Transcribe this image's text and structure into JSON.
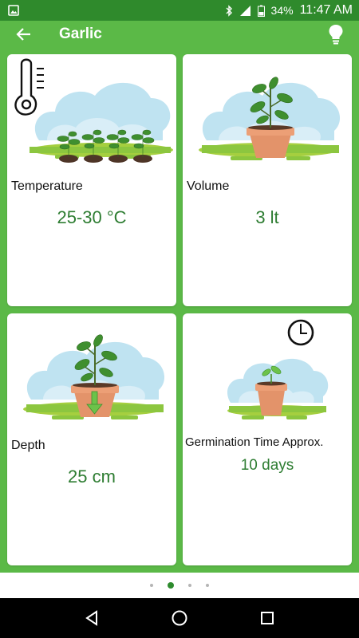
{
  "status_bar": {
    "battery": "34%",
    "time": "11:47 AM"
  },
  "app_bar": {
    "title": "Garlic"
  },
  "cards": [
    {
      "label": "Temperature",
      "value": "25-30 °C"
    },
    {
      "label": "Volume",
      "value": "3 lt"
    },
    {
      "label": "Depth",
      "value": "25 cm"
    },
    {
      "label": "Germination Time Approx.",
      "value": "10 days"
    }
  ],
  "pager": {
    "pages": 4,
    "active": 2
  },
  "colors": {
    "primary": "#5bb947",
    "status": "#2f8a2c",
    "value_text": "#2e7d32"
  }
}
